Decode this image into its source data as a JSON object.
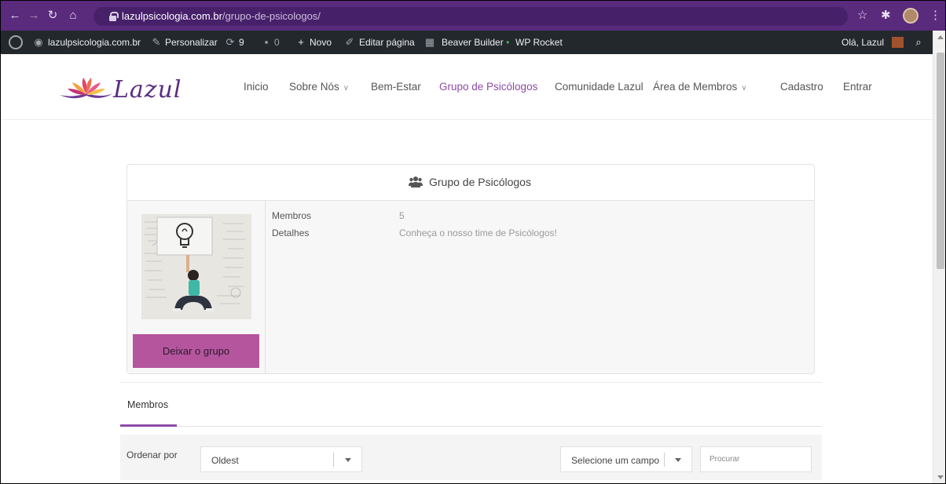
{
  "browser": {
    "url_domain": "lazulpsicologia.com.br",
    "url_path": "/grupo-de-psicologos/"
  },
  "admin_bar": {
    "site_name": "lazulpsicologia.com.br",
    "customize": "Personalizar",
    "updates_count": "9",
    "comments_count": "0",
    "new": "Novo",
    "edit_page": "Editar página",
    "beaver_builder": "Beaver Builder",
    "wp_rocket": "WP Rocket",
    "greeting": "Olá, Lazul"
  },
  "site": {
    "logo_text": "Lazul",
    "logo_color": "#5b2d82",
    "accent_color": "#8e4aa7",
    "button_color": "#b5559e",
    "menu": [
      {
        "label": "Inicio"
      },
      {
        "label": "Sobre Nós"
      },
      {
        "label": "Bem-Estar"
      },
      {
        "label": "Grupo de Psicólogos"
      },
      {
        "label": "Comunidade Lazul"
      },
      {
        "label": "Área de Membros"
      },
      {
        "label": "Cadastro"
      },
      {
        "label": "Entrar"
      }
    ]
  },
  "group": {
    "title": "Grupo de Psicólogos",
    "members_label": "Membros",
    "members_value": "5",
    "details_label": "Detalhes",
    "details_value": "Conheça o nosso time de Psicólogos!",
    "leave_button": "Deixar o grupo"
  },
  "tabs": [
    {
      "label": "Membros",
      "active": true
    }
  ],
  "filters": {
    "sort_label": "Ordenar por",
    "sort_value": "Oldest",
    "field_select": "Selecione um campo",
    "search_placeholder": "Procurar"
  }
}
